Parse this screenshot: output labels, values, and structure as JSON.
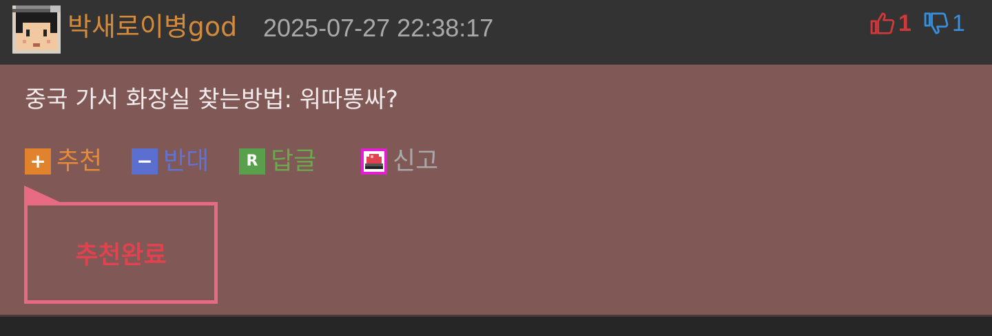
{
  "comment": {
    "username": "박새로이병god",
    "timestamp": "2025-07-27 22:38:17",
    "likes": "1",
    "dislikes": "1",
    "message": "중국 가서 화장실 찾는방법: 워따똥싸?"
  },
  "actions": {
    "recommend": {
      "icon": "+",
      "label": "추천"
    },
    "oppose": {
      "icon": "−",
      "label": "반대"
    },
    "reply": {
      "icon": "R",
      "label": "답글"
    },
    "report": {
      "label": "신고"
    }
  },
  "tooltip": {
    "text": "추천완료"
  },
  "colors": {
    "username": "#d28a3d",
    "like": "#d0393b",
    "dislike": "#3a8edc",
    "body_bg": "#805856",
    "header_bg": "#333333",
    "tooltip": "#e76b82"
  },
  "icons": {
    "avatar": "pixel-avatar-icon",
    "like": "thumbs-up-icon",
    "dislike": "thumbs-down-icon",
    "report": "siren-icon"
  }
}
